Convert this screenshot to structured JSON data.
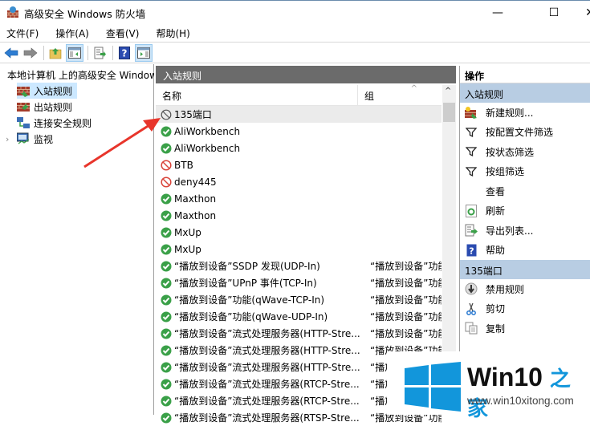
{
  "window": {
    "title": "高级安全 Windows 防火墙",
    "controls": {
      "minimize": "—",
      "maximize": "☐",
      "close": "✕"
    }
  },
  "menu": [
    "文件(F)",
    "操作(A)",
    "查看(V)",
    "帮助(H)"
  ],
  "toolbar": [
    "back-icon",
    "forward-icon",
    "up-folder-icon",
    "show-hide-tree-icon",
    "export-list-icon",
    "help-icon",
    "show-hide-action-pane-icon"
  ],
  "tree": {
    "root": "本地计算机 上的高级安全 Windows 防火墙",
    "items": [
      {
        "label": "入站规则",
        "selected": true
      },
      {
        "label": "出站规则",
        "selected": false
      },
      {
        "label": "连接安全规则",
        "selected": false
      },
      {
        "label": "监视",
        "selected": false,
        "expandable": true
      }
    ]
  },
  "center": {
    "title": "入站规则",
    "columns": [
      "名称",
      "组"
    ],
    "rows": [
      {
        "name": "135端口",
        "group": "",
        "status": "disabled-block",
        "selected": true
      },
      {
        "name": "AliWorkbench",
        "group": "",
        "status": "allow"
      },
      {
        "name": "AliWorkbench",
        "group": "",
        "status": "allow"
      },
      {
        "name": "BTB",
        "group": "",
        "status": "block"
      },
      {
        "name": "deny445",
        "group": "",
        "status": "block"
      },
      {
        "name": "Maxthon",
        "group": "",
        "status": "allow"
      },
      {
        "name": "Maxthon",
        "group": "",
        "status": "allow"
      },
      {
        "name": "MxUp",
        "group": "",
        "status": "allow"
      },
      {
        "name": "MxUp",
        "group": "",
        "status": "allow"
      },
      {
        "name": "“播放到设备”SSDP 发现(UDP-In)",
        "group": "“播放到设备”功能",
        "status": "allow"
      },
      {
        "name": "“播放到设备”UPnP 事件(TCP-In)",
        "group": "“播放到设备”功能",
        "status": "allow"
      },
      {
        "name": "“播放到设备”功能(qWave-TCP-In)",
        "group": "“播放到设备”功能",
        "status": "allow"
      },
      {
        "name": "“播放到设备”功能(qWave-UDP-In)",
        "group": "“播放到设备”功能",
        "status": "allow"
      },
      {
        "name": "“播放到设备”流式处理服务器(HTTP-Stre...",
        "group": "“播放到设备”功能",
        "status": "allow"
      },
      {
        "name": "“播放到设备”流式处理服务器(HTTP-Stre...",
        "group": "“播放到设备”功能",
        "status": "allow"
      },
      {
        "name": "“播放到设备”流式处理服务器(HTTP-Stre...",
        "group": "“播放到设备”功能",
        "status": "allow"
      },
      {
        "name": "“播放到设备”流式处理服务器(RTCP-Stre...",
        "group": "“播放到设备”功能",
        "status": "allow"
      },
      {
        "name": "“播放到设备”流式处理服务器(RTCP-Stre...",
        "group": "“播放到设备”功能",
        "status": "allow"
      },
      {
        "name": "“播放到设备”流式处理服务器(RTSP-Stre...",
        "group": "“播放到设备”功能",
        "status": "allow"
      }
    ]
  },
  "actions": {
    "title": "操作",
    "sections": [
      {
        "title": "入站规则",
        "items": [
          {
            "label": "新建规则...",
            "icon": "new-rule-icon"
          },
          {
            "label": "按配置文件筛选",
            "icon": "filter-icon"
          },
          {
            "label": "按状态筛选",
            "icon": "filter-icon"
          },
          {
            "label": "按组筛选",
            "icon": "filter-icon"
          },
          {
            "label": "查看",
            "icon": ""
          },
          {
            "label": "刷新",
            "icon": "refresh-icon"
          },
          {
            "label": "导出列表...",
            "icon": "export-icon"
          },
          {
            "label": "帮助",
            "icon": "help-icon"
          }
        ]
      },
      {
        "title": "135端口",
        "items": [
          {
            "label": "禁用规则",
            "icon": "disable-rule-icon"
          },
          {
            "label": "剪切",
            "icon": "cut-icon"
          },
          {
            "label": "复制",
            "icon": "copy-icon"
          }
        ]
      }
    ]
  },
  "watermark": {
    "brand": "Win10",
    "brand_suffix": "之家",
    "url": "www.win10xitong.com",
    "brand_color": "#1296db"
  }
}
